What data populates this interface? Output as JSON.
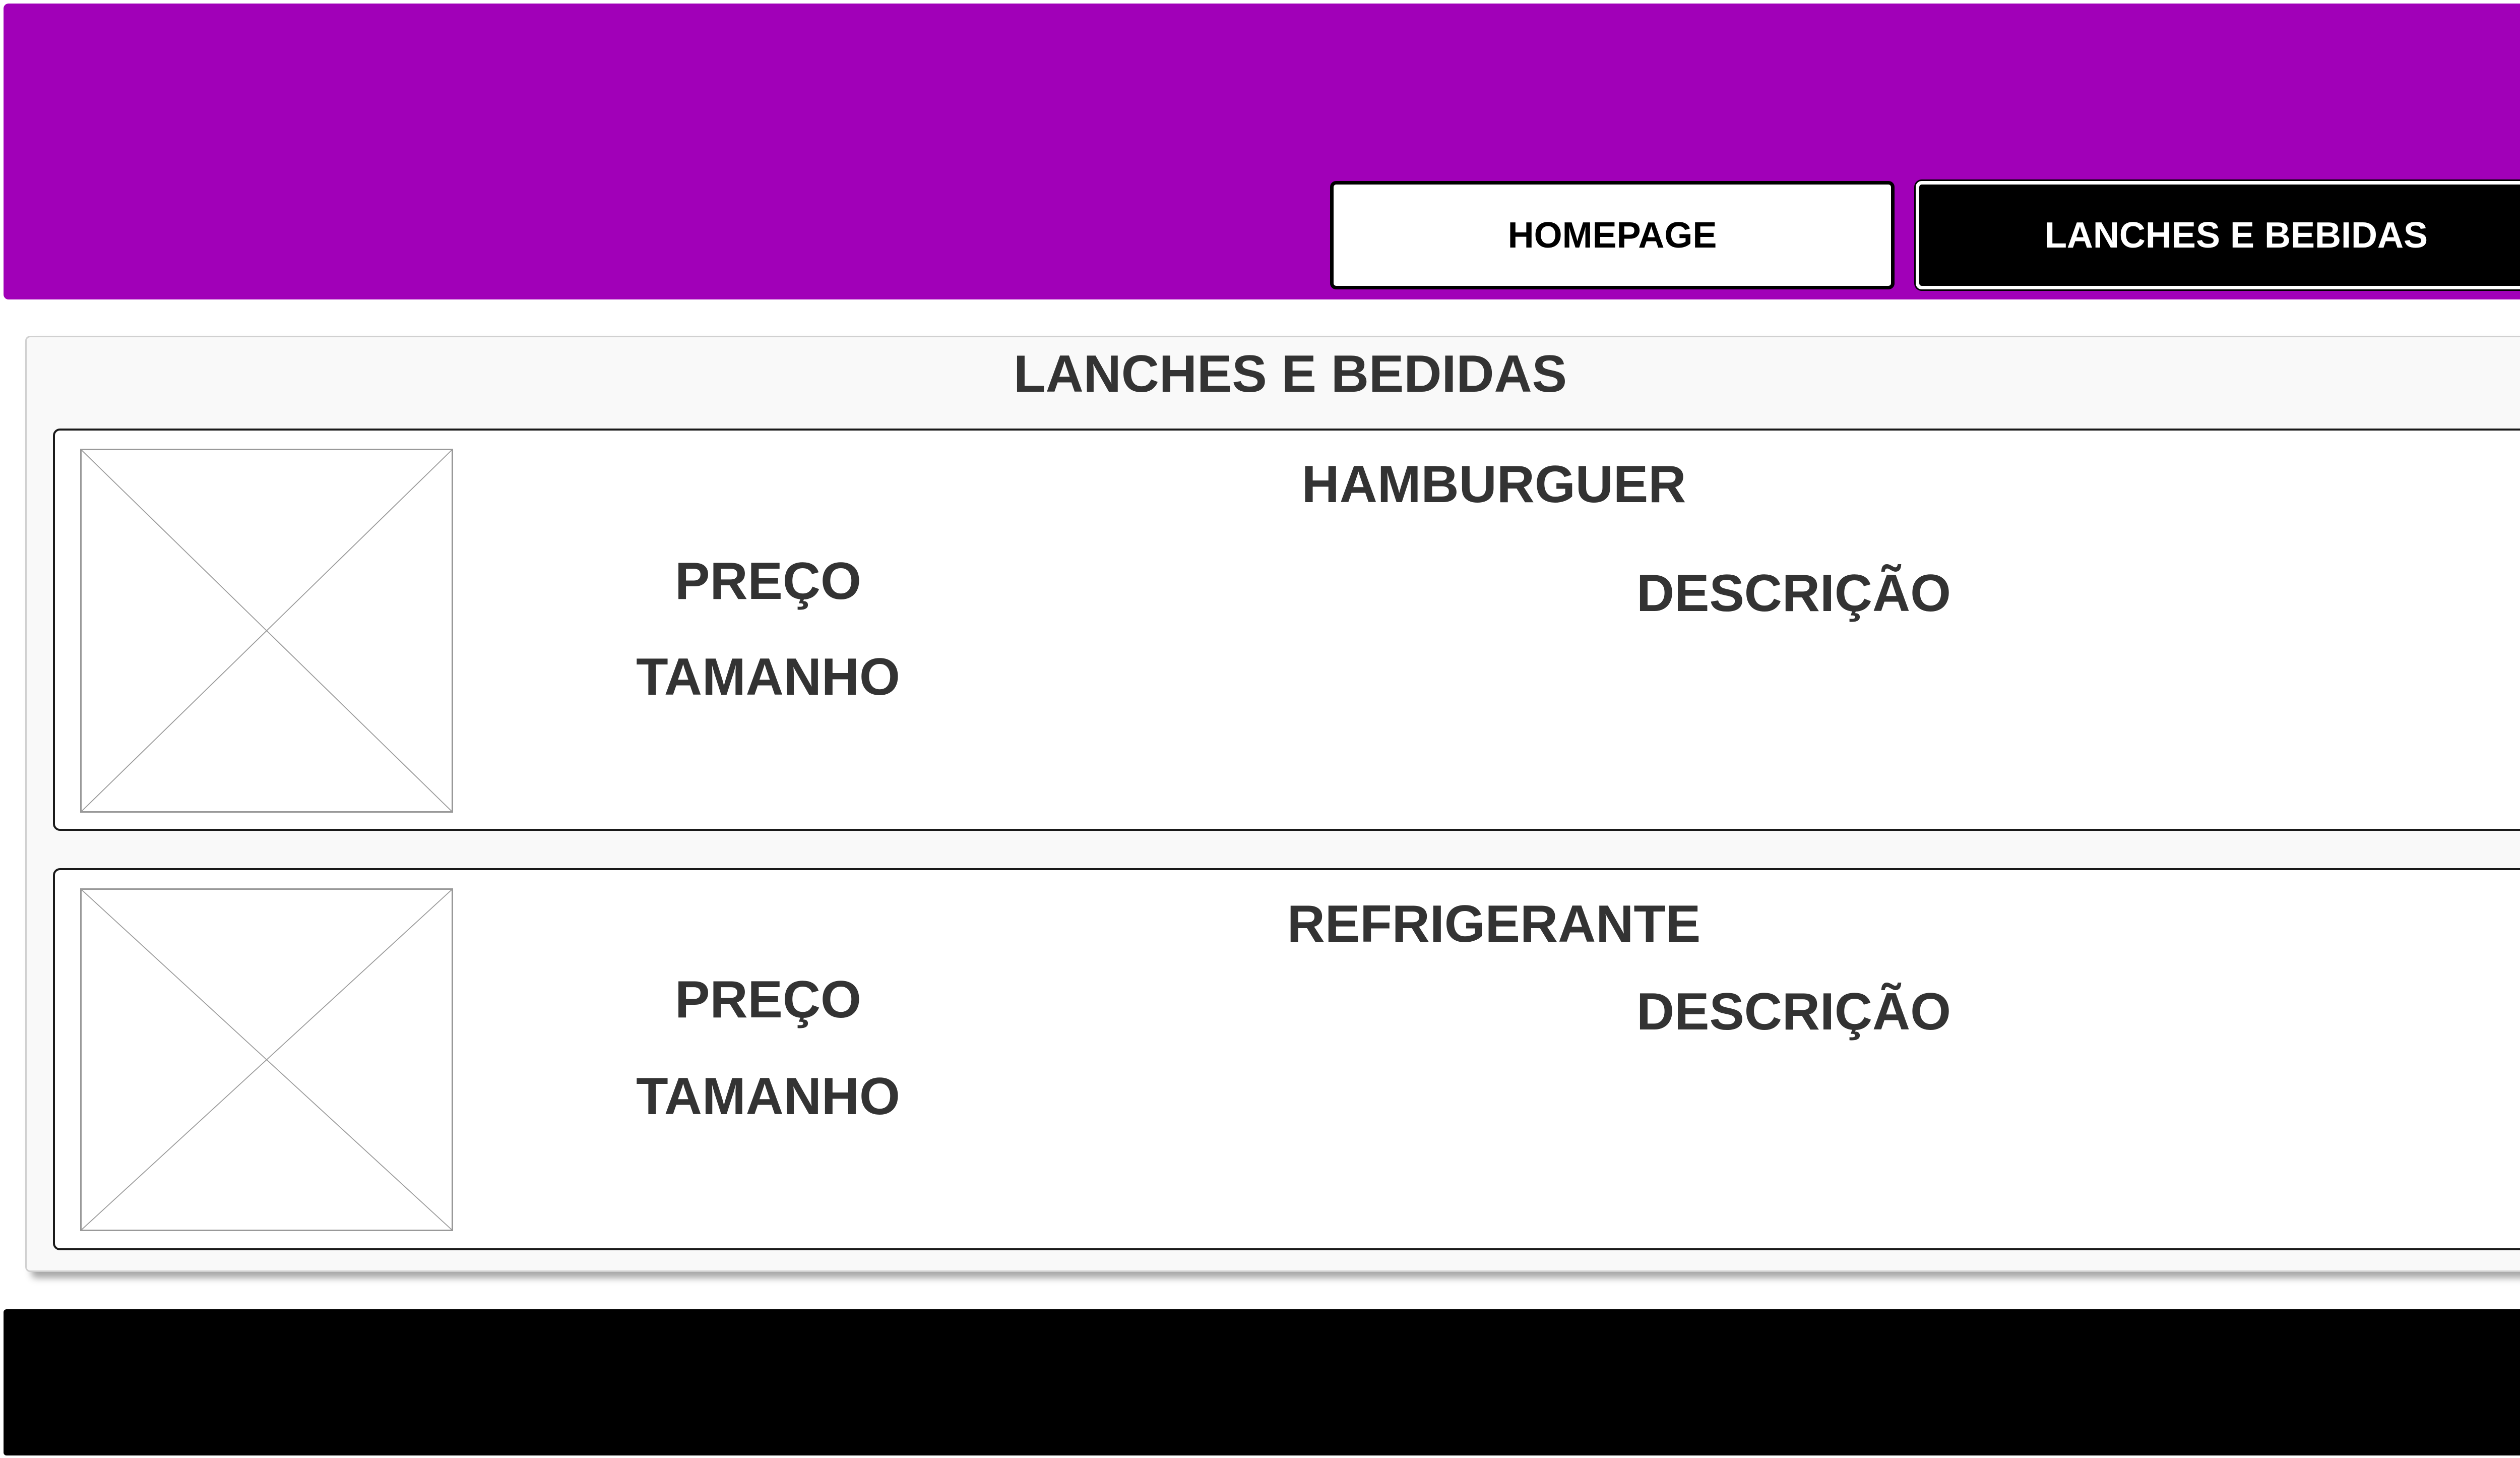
{
  "nav": {
    "homepage_label": "HOMEPAGE",
    "lanches_label": "LANCHES E BEBIDAS"
  },
  "main": {
    "title": "LANCHES E BEDIDAS",
    "items": [
      {
        "name": "HAMBURGUER",
        "price_label": "PREÇO",
        "size_label": "TAMANHO",
        "description_label": "DESCRIÇÃO",
        "image_icon": "image-placeholder-icon"
      },
      {
        "name": "REFRIGERANTE",
        "price_label": "PREÇO",
        "size_label": "TAMANHO",
        "description_label": "DESCRIÇÃO",
        "image_icon": "image-placeholder-icon"
      }
    ]
  },
  "colors": {
    "header": "#a100b8",
    "footer": "#000000",
    "text": "#333333"
  }
}
